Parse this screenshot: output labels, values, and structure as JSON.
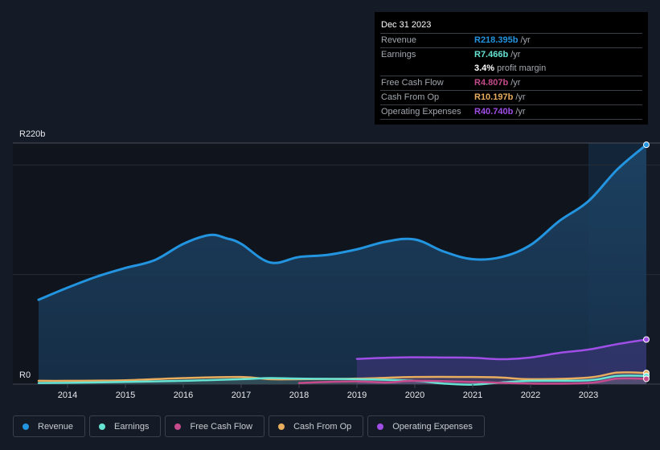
{
  "tooltip": {
    "date": "Dec 31 2023",
    "rows": [
      {
        "label": "Revenue",
        "value": "R218.395b",
        "unit": "/yr",
        "color": "#2394df"
      },
      {
        "label": "Earnings",
        "value": "R7.466b",
        "unit": "/yr",
        "color": "#66e3d3"
      },
      {
        "label": "",
        "value": "3.4%",
        "unit": "profit margin",
        "color": "#ffffff"
      },
      {
        "label": "Free Cash Flow",
        "value": "R4.807b",
        "unit": "/yr",
        "color": "#c64b8c"
      },
      {
        "label": "Cash From Op",
        "value": "R10.197b",
        "unit": "/yr",
        "color": "#e8ad5f"
      },
      {
        "label": "Operating Expenses",
        "value": "R40.740b",
        "unit": "/yr",
        "color": "#9f4ee6"
      }
    ]
  },
  "legend": [
    {
      "label": "Revenue",
      "color": "#2394df"
    },
    {
      "label": "Earnings",
      "color": "#66e3d3"
    },
    {
      "label": "Free Cash Flow",
      "color": "#c64b8c"
    },
    {
      "label": "Cash From Op",
      "color": "#e8ad5f"
    },
    {
      "label": "Operating Expenses",
      "color": "#9f4ee6"
    }
  ],
  "chart_data": {
    "type": "area",
    "title": "",
    "xlabel": "",
    "ylabel": "",
    "currency_prefix": "R",
    "y_unit": "b",
    "ylim": [
      0,
      220
    ],
    "y_tick_labels": [
      "R0",
      "R220b"
    ],
    "y_gridlines": [
      0,
      100,
      200,
      220
    ],
    "xlim": [
      2013.5,
      2024.0
    ],
    "x_ticks": [
      2014,
      2015,
      2016,
      2017,
      2018,
      2019,
      2020,
      2021,
      2022,
      2023
    ],
    "x_tick_labels": [
      "2014",
      "2015",
      "2016",
      "2017",
      "2018",
      "2019",
      "2020",
      "2021",
      "2022",
      "2023"
    ],
    "highlight_from": 2023.0,
    "legend_position": "bottom",
    "series": [
      {
        "name": "Revenue",
        "color": "#2394df",
        "x": [
          2013.5,
          2014.0,
          2014.5,
          2015.0,
          2015.5,
          2016.0,
          2016.45,
          2016.75,
          2017.0,
          2017.5,
          2018.0,
          2018.5,
          2019.0,
          2019.5,
          2020.0,
          2020.5,
          2021.0,
          2021.5,
          2022.0,
          2022.5,
          2023.0,
          2023.5,
          2024.0
        ],
        "values": [
          77,
          88,
          98,
          106,
          113,
          128,
          136,
          133,
          128,
          111,
          116,
          118,
          123,
          130,
          132,
          121,
          114,
          116,
          127,
          149,
          167,
          196,
          218.4
        ]
      },
      {
        "name": "Operating Expenses",
        "color": "#9f4ee6",
        "x": [
          2019.0,
          2019.5,
          2020.0,
          2020.5,
          2021.0,
          2021.5,
          2022.0,
          2022.5,
          2023.0,
          2023.5,
          2024.0
        ],
        "values": [
          23,
          24,
          24.5,
          24.3,
          24,
          22.7,
          24.3,
          28.5,
          31.5,
          36.5,
          40.7
        ]
      },
      {
        "name": "Cash From Op",
        "color": "#e8ad5f",
        "x": [
          2013.5,
          2014.0,
          2015.0,
          2016.0,
          2017.0,
          2017.5,
          2018.0,
          2019.0,
          2020.0,
          2021.0,
          2021.5,
          2022.0,
          2023.0,
          2023.5,
          2024.0
        ],
        "values": [
          3,
          3,
          3.5,
          5.5,
          6.5,
          4.5,
          4.5,
          5,
          6.5,
          6.5,
          6,
          4.5,
          6,
          10.5,
          10.2
        ]
      },
      {
        "name": "Earnings",
        "color": "#66e3d3",
        "x": [
          2013.5,
          2014.0,
          2015.0,
          2016.0,
          2017.0,
          2017.5,
          2018.0,
          2019.0,
          2020.0,
          2020.5,
          2021.0,
          2021.5,
          2022.0,
          2023.0,
          2023.5,
          2024.0
        ],
        "values": [
          1,
          1.2,
          2,
          3,
          4.5,
          5.5,
          5,
          4.5,
          3,
          0.5,
          -0.5,
          1.5,
          3,
          3.5,
          7.5,
          7.5
        ]
      },
      {
        "name": "Free Cash Flow",
        "color": "#c64b8c",
        "x": [
          2018.0,
          2018.5,
          2019.0,
          2019.5,
          2020.0,
          2021.0,
          2022.0,
          2023.0,
          2023.5,
          2024.0
        ],
        "values": [
          1,
          2,
          2.5,
          1.5,
          3,
          2,
          0.5,
          1,
          5,
          4.8
        ]
      }
    ]
  }
}
